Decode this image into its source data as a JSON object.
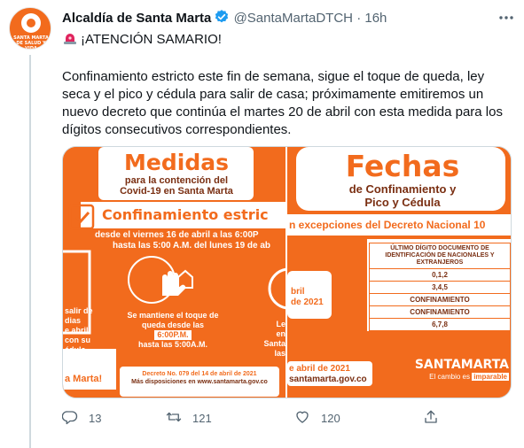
{
  "author": {
    "name": "Alcaldía de Santa Marta",
    "handle": "@SantaMartaDTCH",
    "separator": "·",
    "time": "16h",
    "avatar_text": "SANTA MARTA DE SALUD Y VIDA"
  },
  "tweet": {
    "alert_line": "¡ATENCIÓN SAMARIO!",
    "body": "Confinamiento estricto este fin de semana, sigue el toque de queda, ley seca y el pico y cédula para salir de casa; próximamente emitiremos un nuevo decreto que continúa el martes 20 de abril con esta medida para los dígitos consecutivos correspondientes."
  },
  "image_left": {
    "title": "Medidas",
    "subtitle_1": "para la contención del",
    "subtitle_2": "Covid-19 en Santa Marta",
    "banner": "Confinamiento estric",
    "dates_1": "desde el viernes 16 de abril a las 6:00P",
    "dates_2": "hasta las 5:00 A.M. del lunes 19 de ab",
    "side_left_1": "salir de",
    "side_left_2": "dias",
    "side_left_3": "e abril",
    "side_left_4": "con su",
    "side_left_5": "édula.",
    "curfew_1": "Se mantiene el toque de",
    "curfew_2": "queda desde las",
    "curfew_3": "6:00P.M.",
    "curfew_4": "hasta las 5:00A.M.",
    "side_right_1": "Le",
    "side_right_2": "en Santa",
    "side_right_3": "las",
    "footer_left": "a Marta!",
    "decree": "Decreto No. 079 del 14 de abril de 2021",
    "more_info": "Más disposiciones en www.santamarta.gov.co"
  },
  "image_right": {
    "title": "Fechas",
    "subtitle_1": "de Confinamiento y",
    "subtitle_2": "Pico y Cédula",
    "banner": "n excepciones del Decreto Nacional 10",
    "left_frag_1": "bril",
    "left_frag_2": "de 2021",
    "table_header": "ÚLTIMO DÍGITO DOCUMENTO DE IDENTIFICACIÓN DE NACIONALES Y EXTRANJEROS",
    "rows": [
      "0,1,2",
      "3,4,5",
      "CONFINAMIENTO",
      "CONFINAMIENTO",
      "6,7,8"
    ],
    "footer_date": "e abril de 2021",
    "footer_site": "santamarta.gov.co",
    "brand": "SANTAMARTA",
    "tagline_1": "El cambio es",
    "tagline_2": "imparable"
  },
  "actions": {
    "reply_count": "13",
    "retweet_count": "121",
    "like_count": "120"
  },
  "colors": {
    "brand_orange": "#f26b1d",
    "verified_blue": "#1d9bf0",
    "muted": "#536471",
    "text": "#0f1419"
  },
  "icons": [
    "verified-badge-icon",
    "more-icon",
    "siren-icon",
    "reply-icon",
    "retweet-icon",
    "like-icon",
    "share-icon"
  ]
}
